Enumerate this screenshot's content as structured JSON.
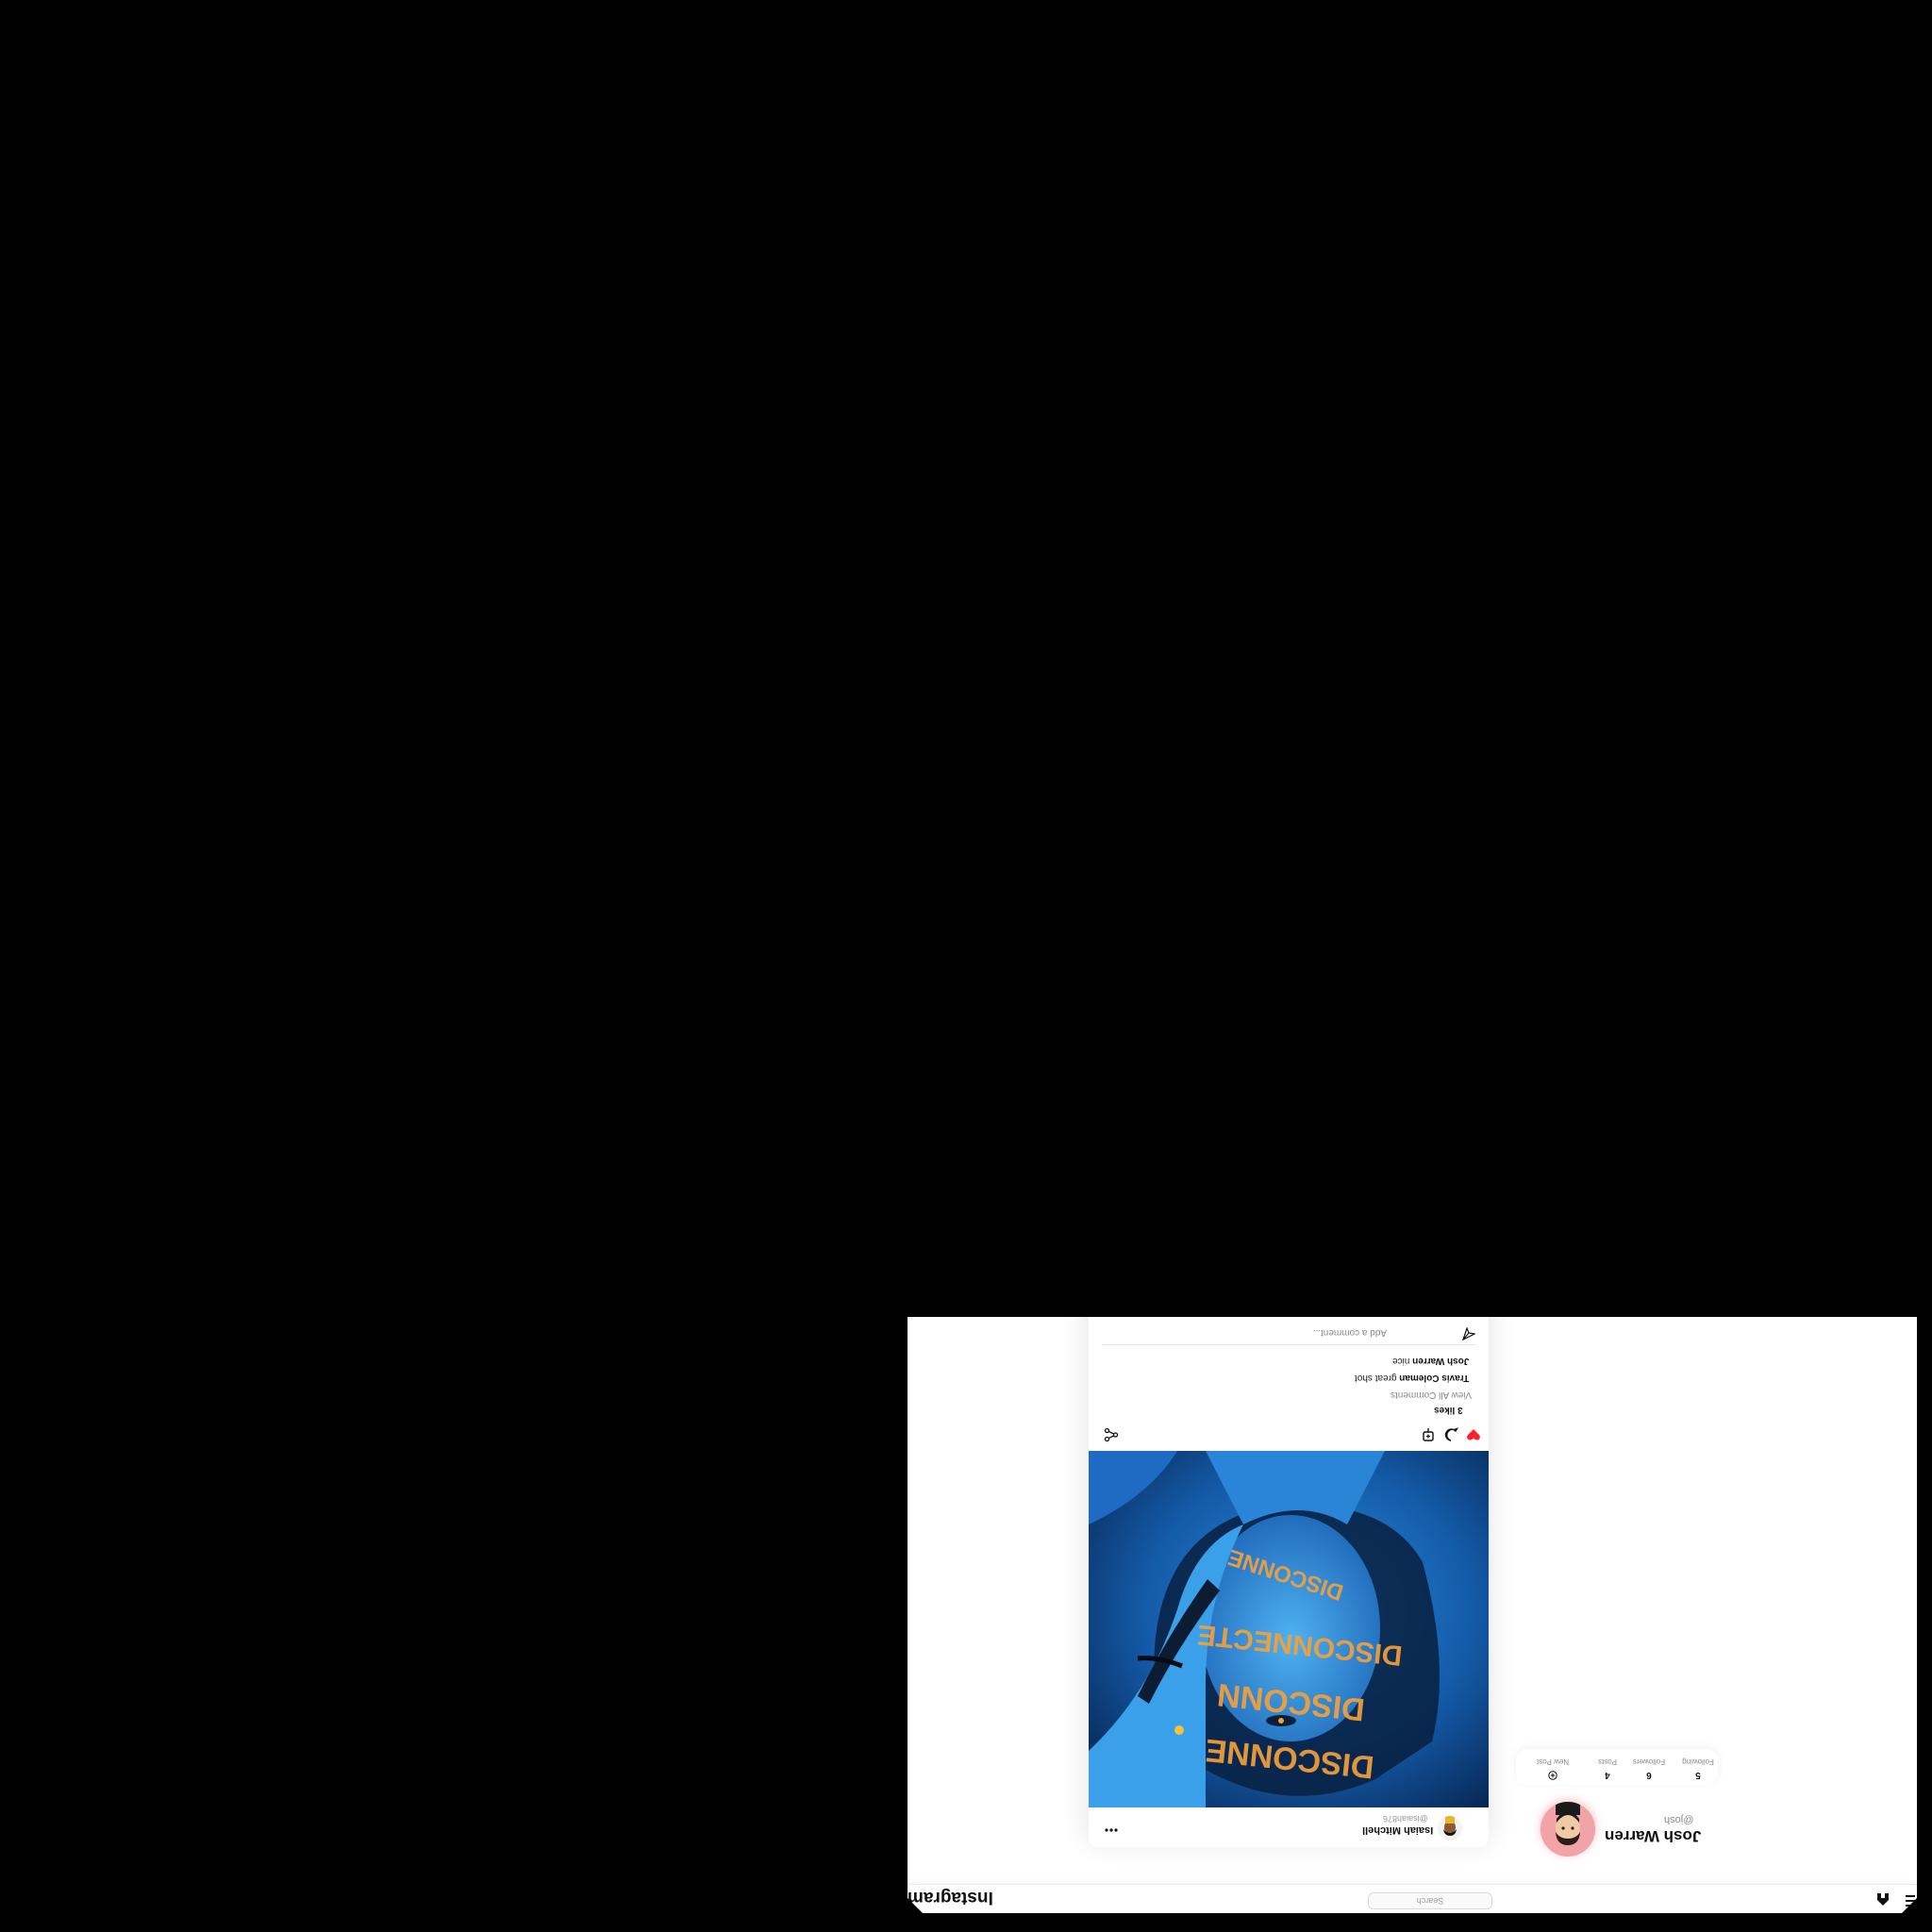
{
  "app": {
    "logo": "Instagram",
    "search_placeholder": "Search"
  },
  "profile": {
    "name": "Josh Warren",
    "handle": "@josh",
    "stats": [
      {
        "label": "Following",
        "value": "5"
      },
      {
        "label": "Followers",
        "value": "6"
      },
      {
        "label": "Posts",
        "value": "4"
      },
      {
        "label": "New Post",
        "value": "",
        "icon": "plus-circle-icon"
      }
    ]
  },
  "post": {
    "author": "Isaiah Mitchell",
    "handle": "@isaiah876",
    "likes": "3 likes",
    "view_all": "View All Comments",
    "comments": [
      {
        "user": "Travis Coleman",
        "text": "great shot"
      },
      {
        "user": "Josh Warren",
        "text": "nice"
      }
    ],
    "comment_placeholder": "Add a comment...",
    "liked": true,
    "image_words": [
      "DISCONNE",
      "DISCONN",
      "DISCONNECTE",
      "DISCONNE"
    ]
  },
  "colors": {
    "like": "#ff1f2d",
    "avatar_bg": "#f2a3a8",
    "image_blue": "#1e78c8",
    "image_orange": "#f5a03a"
  }
}
